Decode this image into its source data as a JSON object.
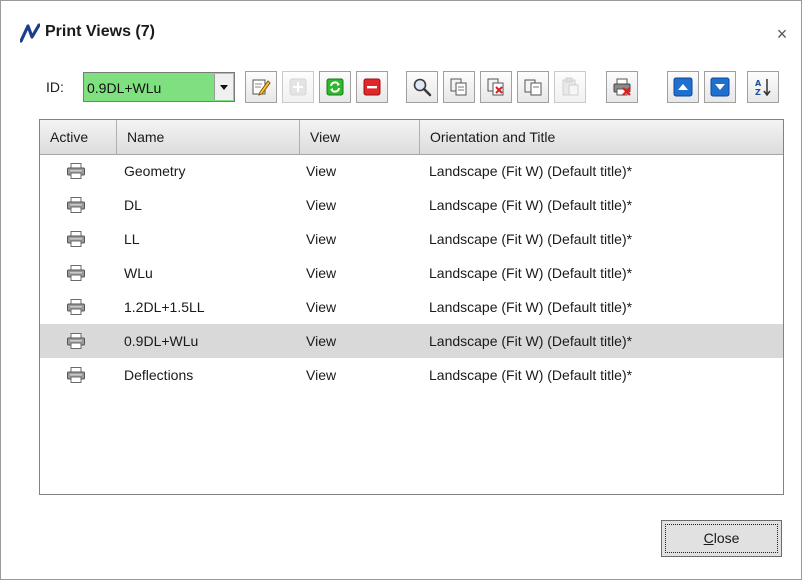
{
  "window": {
    "title": "Print Views (7)",
    "close_glyph": "×"
  },
  "toolbar": {
    "id_label": "ID:",
    "id_value": "0.9DL+WLu",
    "id_field_color": "#7fe07f",
    "buttons": [
      {
        "icon": "edit-icon",
        "enabled": true
      },
      {
        "icon": "add-icon",
        "enabled": false
      },
      {
        "icon": "refresh-icon",
        "enabled": true
      },
      {
        "icon": "delete-icon",
        "enabled": true
      },
      {
        "icon": "search-icon",
        "enabled": true
      },
      {
        "icon": "copy-icon",
        "enabled": true
      },
      {
        "icon": "cut-icon",
        "enabled": true
      },
      {
        "icon": "duplicate-icon",
        "enabled": true
      },
      {
        "icon": "paste-icon",
        "enabled": false
      },
      {
        "icon": "print-delete-icon",
        "enabled": true
      },
      {
        "icon": "move-up-icon",
        "enabled": true
      },
      {
        "icon": "move-down-icon",
        "enabled": true
      },
      {
        "icon": "sort-az-icon",
        "enabled": true
      }
    ]
  },
  "list": {
    "columns": [
      "Active",
      "Name",
      "View",
      "Orientation and Title"
    ],
    "rows": [
      {
        "active_icon": "printer-icon",
        "name": "Geometry",
        "view": "View",
        "orientation": "Landscape (Fit W) (Default title)*",
        "selected": false
      },
      {
        "active_icon": "printer-icon",
        "name": "DL",
        "view": "View",
        "orientation": "Landscape (Fit W) (Default title)*",
        "selected": false
      },
      {
        "active_icon": "printer-icon",
        "name": "LL",
        "view": "View",
        "orientation": "Landscape (Fit W) (Default title)*",
        "selected": false
      },
      {
        "active_icon": "printer-icon",
        "name": "WLu",
        "view": "View",
        "orientation": "Landscape (Fit W) (Default title)*",
        "selected": false
      },
      {
        "active_icon": "printer-icon",
        "name": "1.2DL+1.5LL",
        "view": "View",
        "orientation": "Landscape (Fit W) (Default title)*",
        "selected": false
      },
      {
        "active_icon": "printer-icon",
        "name": "0.9DL+WLu",
        "view": "View",
        "orientation": "Landscape (Fit W) (Default title)*",
        "selected": true
      },
      {
        "active_icon": "printer-icon",
        "name": "Deflections",
        "view": "View",
        "orientation": "Landscape (Fit W) (Default title)*",
        "selected": false
      }
    ]
  },
  "footer": {
    "close_label_accel": "C",
    "close_label_rest": "lose"
  },
  "colors": {
    "selection": "#d9d9d9",
    "accent_blue": "#1f6fd0",
    "logo_blue": "#1a3f8f"
  }
}
